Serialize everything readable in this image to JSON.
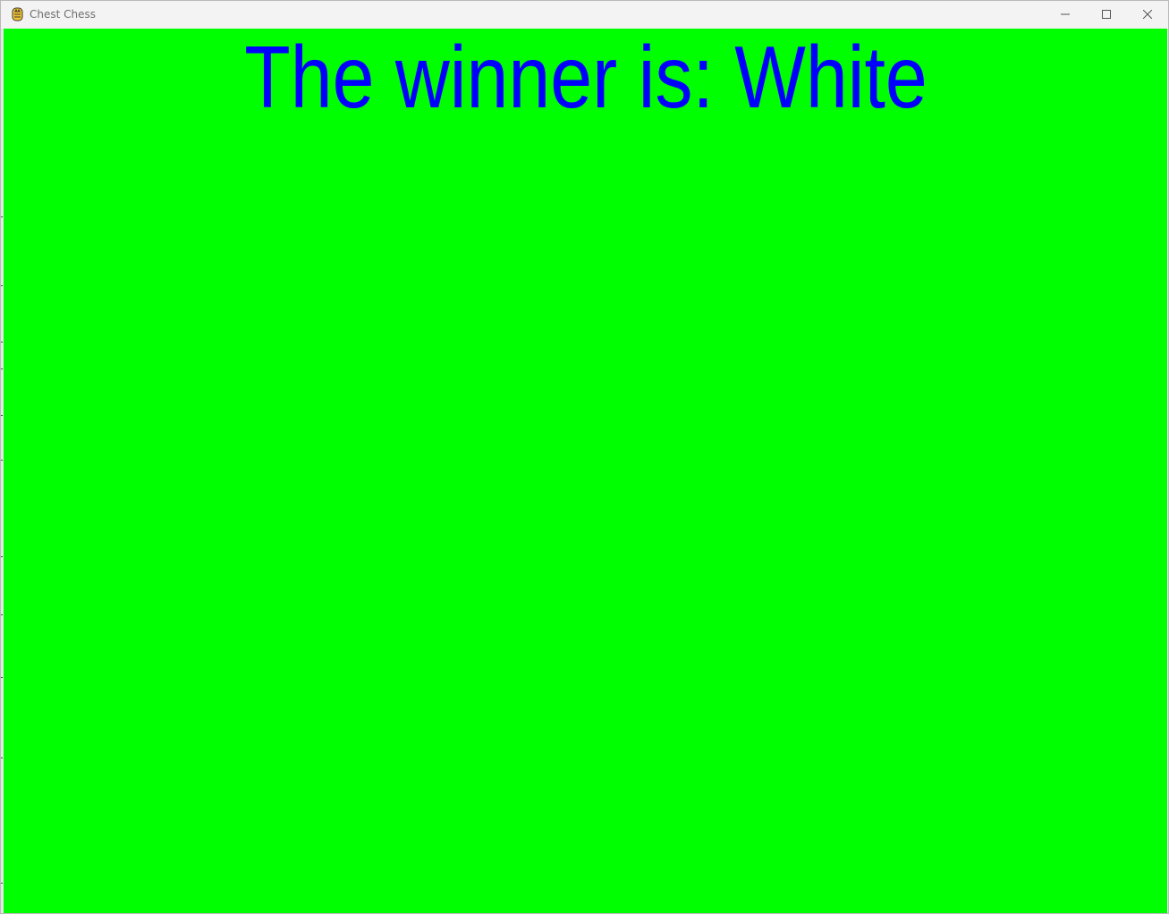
{
  "window": {
    "title": "Chest Chess",
    "app_icon": "pygame-snake-icon",
    "controls": [
      "minimize-icon",
      "maximize-icon",
      "close-icon"
    ]
  },
  "game": {
    "message": "The winner is: White",
    "background_color": "#00ff00",
    "text_color": "#0000ff"
  }
}
